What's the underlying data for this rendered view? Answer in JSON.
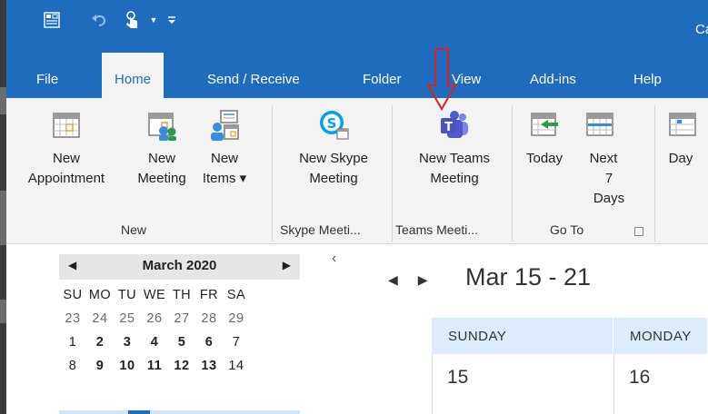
{
  "window": {
    "title": "Cal"
  },
  "quick_access": {
    "items": [
      "ribbon-icon",
      "undo-icon",
      "touch-mode-icon",
      "dropdown-icon",
      "customize-icon"
    ]
  },
  "tabs": [
    {
      "label": "File",
      "active": false
    },
    {
      "label": "Home",
      "active": true
    },
    {
      "label": "Send / Receive",
      "active": false
    },
    {
      "label": "Folder",
      "active": false
    },
    {
      "label": "View",
      "active": false
    },
    {
      "label": "Add-ins",
      "active": false
    },
    {
      "label": "Help",
      "active": false
    }
  ],
  "ribbon": {
    "groups": [
      {
        "label": "New",
        "buttons": [
          {
            "line1": "New",
            "line2": "Appointment"
          },
          {
            "line1": "New",
            "line2": "Meeting"
          },
          {
            "line1": "New",
            "line2": "Items ▾"
          }
        ]
      },
      {
        "label": "Skype Meeti...",
        "buttons": [
          {
            "line1": "New Skype",
            "line2": "Meeting"
          }
        ]
      },
      {
        "label": "Teams Meeti...",
        "buttons": [
          {
            "line1": "New Teams",
            "line2": "Meeting"
          }
        ]
      },
      {
        "label": "Go To",
        "buttons": [
          {
            "line1": "Today",
            "line2": ""
          },
          {
            "line1": "Next",
            "line2": "7 Days"
          }
        ]
      },
      {
        "label": "",
        "buttons": [
          {
            "line1": "Day",
            "line2": ""
          }
        ]
      }
    ]
  },
  "mini_calendar": {
    "title": "March 2020",
    "weekdays": [
      "SU",
      "MO",
      "TU",
      "WE",
      "TH",
      "FR",
      "SA"
    ],
    "weeks": [
      [
        "23",
        "24",
        "25",
        "26",
        "27",
        "28",
        "29"
      ],
      [
        "1",
        "2",
        "3",
        "4",
        "5",
        "6",
        "7"
      ],
      [
        "8",
        "9",
        "10",
        "11",
        "12",
        "13",
        "14"
      ]
    ]
  },
  "calendar_view": {
    "date_range": "Mar 15 - 21",
    "days": [
      {
        "name": "SUNDAY",
        "date": "15"
      },
      {
        "name": "MONDAY",
        "date": "16"
      }
    ]
  },
  "colors": {
    "accent": "#1f6cbf",
    "ribbon_bg": "#f3f3f3",
    "day_header_bg": "#dcecfa",
    "annotation_arrow": "#e02020"
  }
}
